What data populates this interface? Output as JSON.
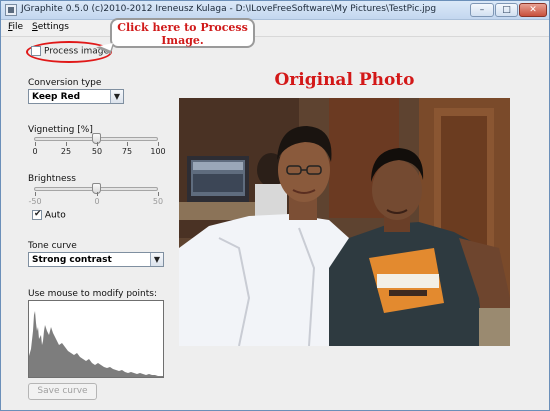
{
  "window": {
    "title": "JGraphite 0.5.0 (c)2010-2012 Ireneusz Kulaga - D:\\ILoveFreeSoftware\\My Pictures\\TestPic.jpg",
    "controls": [
      "–",
      "□",
      "✕"
    ]
  },
  "menu": {
    "items": [
      {
        "mnemonic": "F",
        "rest": "ile"
      },
      {
        "mnemonic": "S",
        "rest": "ettings"
      }
    ]
  },
  "process": {
    "label": "Process image",
    "checked": false
  },
  "callout": {
    "line1": "Click here to Process",
    "line2": "Image."
  },
  "conversion": {
    "label": "Conversion type",
    "value": "Keep Red"
  },
  "vignetting": {
    "label": "Vignetting [%]",
    "value": 50,
    "min": 0,
    "max": 100,
    "ticks": [
      "0",
      "25",
      "50",
      "75",
      "100"
    ]
  },
  "brightness": {
    "label": "Brightness",
    "value": 0,
    "min": -50,
    "max": 50,
    "ticks": [
      "-50",
      "0",
      "50"
    ],
    "auto_label": "Auto",
    "auto_checked": true
  },
  "tone": {
    "label": "Tone curve",
    "value": "Strong contrast"
  },
  "histogram": {
    "label": "Use mouse to modify points:",
    "color": "#7d7d7d"
  },
  "save_button": {
    "label": "Save curve",
    "enabled": false
  },
  "photo": {
    "title": "Original Photo"
  },
  "colors": {
    "accent_red": "#d31818",
    "window_border": "#6b8fb9",
    "panel_bg": "#eeeeee"
  }
}
